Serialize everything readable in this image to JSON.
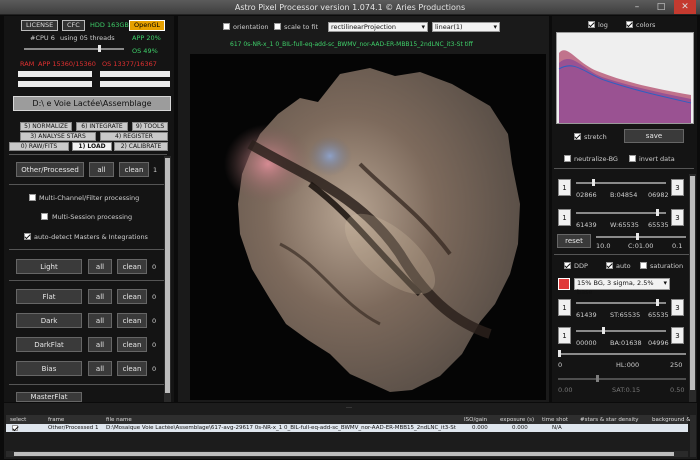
{
  "window": {
    "title": "Astro Pixel Processor version 1.074.1 © Aries Productions",
    "minimize": "–",
    "maximize": "□",
    "close": "✕"
  },
  "top_left": {
    "license": "LICENSE",
    "cfc": "CFC",
    "hdd": "HDD 163GB",
    "opengl": "OpenGL",
    "cpu": "#CPU 6",
    "threads": "using 05 threads",
    "app_pct": "APP 20%",
    "os_pct": "OS 49%",
    "ram_label": "RAM",
    "app_ram": "APP 15360/15360",
    "os_ram": "OS 13377/16367",
    "dir_button": "D:\\   e Voie Lactée\\Assemblage"
  },
  "tabs": [
    {
      "label": "5) NORMALIZE",
      "active": false
    },
    {
      "label": "6) INTEGRATE",
      "active": false
    },
    {
      "label": "9) TOOLS",
      "active": false
    },
    {
      "label": "3) ANALYSE STARS",
      "active": false
    },
    {
      "label": "4) REGISTER",
      "active": false
    },
    {
      "label": "0) RAW/FITS",
      "active": false
    },
    {
      "label": "1) LOAD",
      "active": true
    },
    {
      "label": "2) CALIBRATE",
      "active": false
    }
  ],
  "load": {
    "other_processed": {
      "label": "Other/Processed",
      "all": "all",
      "clean": "clean",
      "count": "1"
    },
    "multi_channel": "Multi-Channel/Filter processing",
    "multi_session": "Multi-Session processing",
    "auto_detect": "auto-detect Masters & Integrations",
    "frames": [
      {
        "label": "Light",
        "all": "all",
        "clean": "clean",
        "count": "0"
      },
      {
        "label": "Flat",
        "all": "all",
        "clean": "clean",
        "count": "0"
      },
      {
        "label": "Dark",
        "all": "all",
        "clean": "clean",
        "count": "0"
      },
      {
        "label": "DarkFlat",
        "all": "all",
        "clean": "clean",
        "count": "0"
      },
      {
        "label": "Bias",
        "all": "all",
        "clean": "clean",
        "count": "0"
      },
      {
        "label": "MasterFlat",
        "all": "",
        "clean": "",
        "count": ""
      }
    ]
  },
  "viewer": {
    "orientation": "orientation",
    "scale_to_fit": "scale to fit",
    "projection": "rectilinearProjection",
    "stretch_mode": "linear(1)",
    "filename": "617 0s-NR-x_1 0_BIL-full-eq-add-sc_BWMV_nor-AAD-ER-MBB15_2ndLNC_it3-St tiff"
  },
  "right": {
    "log": "log",
    "colors": "colors",
    "stretch": "stretch",
    "save": "save",
    "neutralize": "neutralize-BG",
    "invert": "invert data",
    "row1": {
      "left": "02866",
      "mid": "B:04854",
      "right": "06982"
    },
    "row2": {
      "left": "61439",
      "mid": "W:65535",
      "right": "65535"
    },
    "reset": "reset",
    "row3": {
      "left": "10.0",
      "mid": "C:01.00",
      "right": "0.1"
    },
    "ddp": "DDP",
    "auto": "auto",
    "saturation": "saturation",
    "ddp_mode": "15% BG, 3 sigma, 2.5% base",
    "row4": {
      "left": "61439",
      "mid": "ST:65535",
      "right": "65535"
    },
    "row5": {
      "left": "00000",
      "mid": "BA:01638",
      "right": "04996"
    },
    "row6": {
      "left": "0",
      "mid": "HL:000",
      "right": "250"
    },
    "row7": {
      "left": "0.00",
      "mid": "SAT:0.15",
      "right": "0.50"
    },
    "btn_1": "1",
    "btn_3": "3"
  },
  "table": {
    "headers": [
      "select",
      "frame",
      "file name",
      "ISO/gain",
      "exposure (s)",
      "time shot",
      "#stars & star density",
      "background &"
    ],
    "row": [
      "",
      "Other/Processed 1",
      "D:\\Mosaique Voie Lactée\\Assemblage\\617-avg-29617 0s-NR-x_1 0_BIL-full-eq-add-sc_BWMV_nor-AAD-ER-MBB15_2ndLNC_it3-St tiff",
      "0.000",
      "0.000",
      "N/A",
      "",
      ""
    ]
  },
  "colors": {
    "accent_green": "#3fd16a",
    "alert_red": "#e03030",
    "opengl": "#e6a000"
  }
}
